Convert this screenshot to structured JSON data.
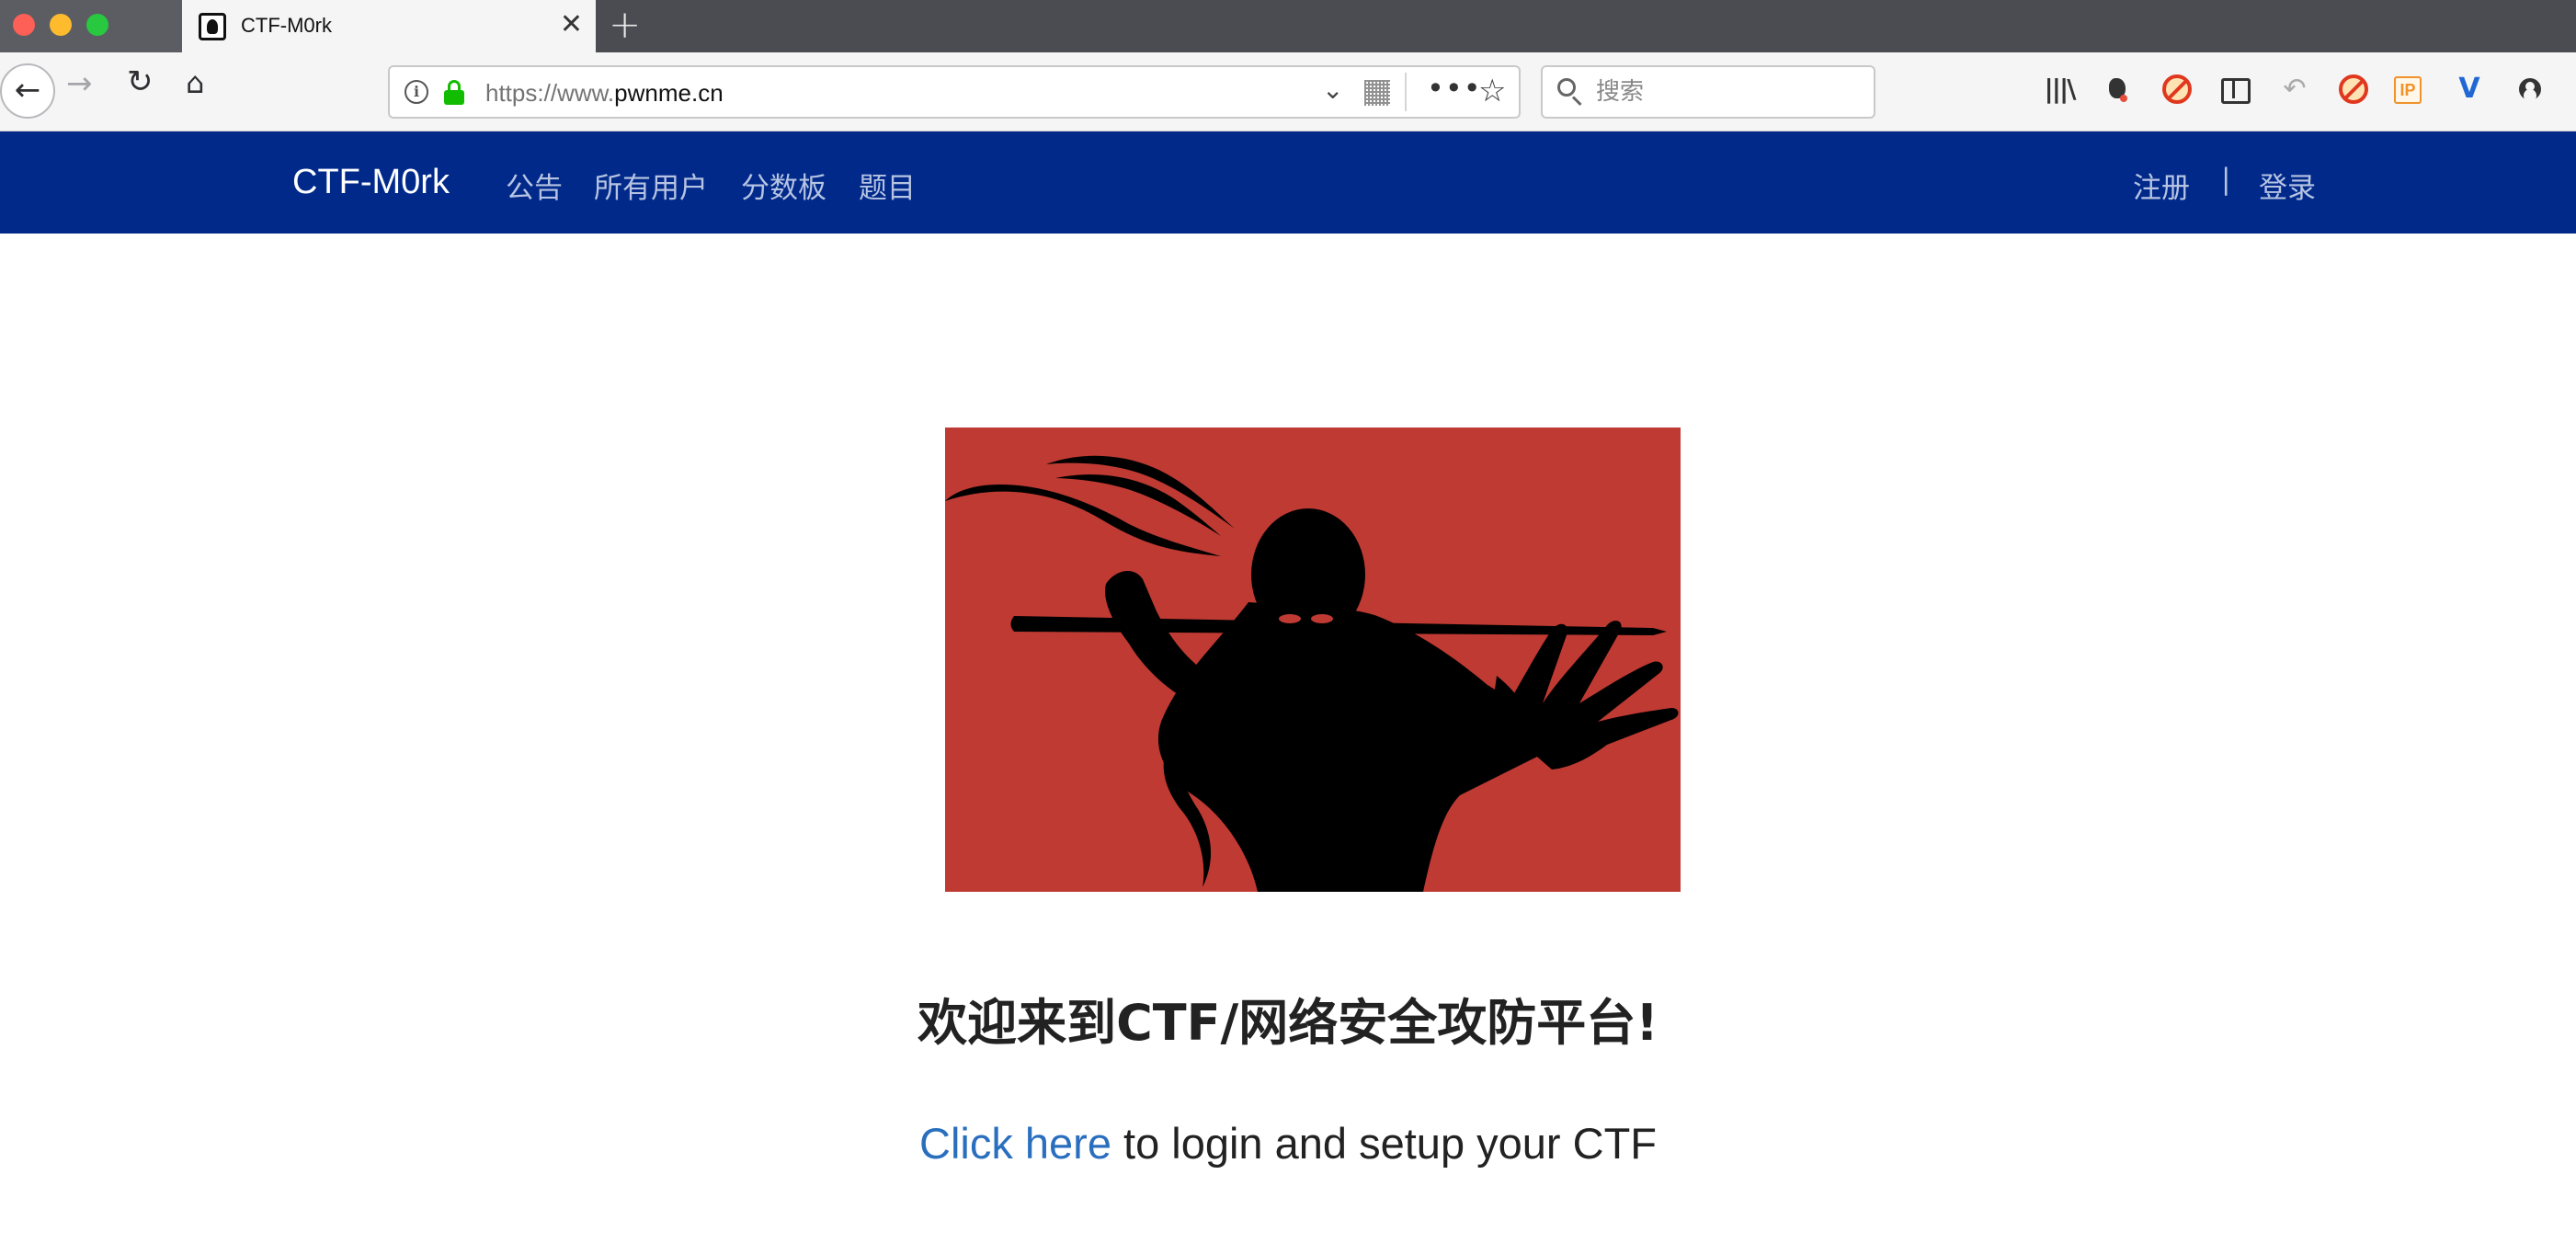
{
  "browser": {
    "tab": {
      "title": "CTF-M0rk",
      "close_glyph": "✕"
    },
    "new_tab_glyph": "+",
    "toolbar": {
      "back_glyph": "←",
      "forward_glyph": "→",
      "reload_glyph": "↻",
      "home_glyph": "⌂"
    },
    "url": {
      "scheme_prefix": "https://www.",
      "domain": "pwnme.cn"
    },
    "url_icons": {
      "info": "i",
      "chevron": "⌄",
      "more": "•••",
      "star": "☆"
    },
    "search": {
      "placeholder": "搜索"
    },
    "extension_icons": {
      "library": "|||\\",
      "undo": "↶",
      "ip": "IP",
      "v": "V"
    }
  },
  "site": {
    "brand": "CTF-M0rk",
    "nav_links": [
      "公告",
      "所有用户",
      "分数板",
      "题目"
    ],
    "auth": {
      "register": "注册",
      "separator": "|",
      "login": "登录"
    }
  },
  "main": {
    "hero_image": {
      "background_color": "#bf3a32",
      "silhouette_color": "#000000"
    },
    "welcome": "欢迎来到CTF/网络安全攻防平台!",
    "login_link": "Click here",
    "login_rest": " to login and setup your CTF"
  },
  "colors": {
    "navbar_bg": "#00298a",
    "link": "#2a6fbe"
  }
}
